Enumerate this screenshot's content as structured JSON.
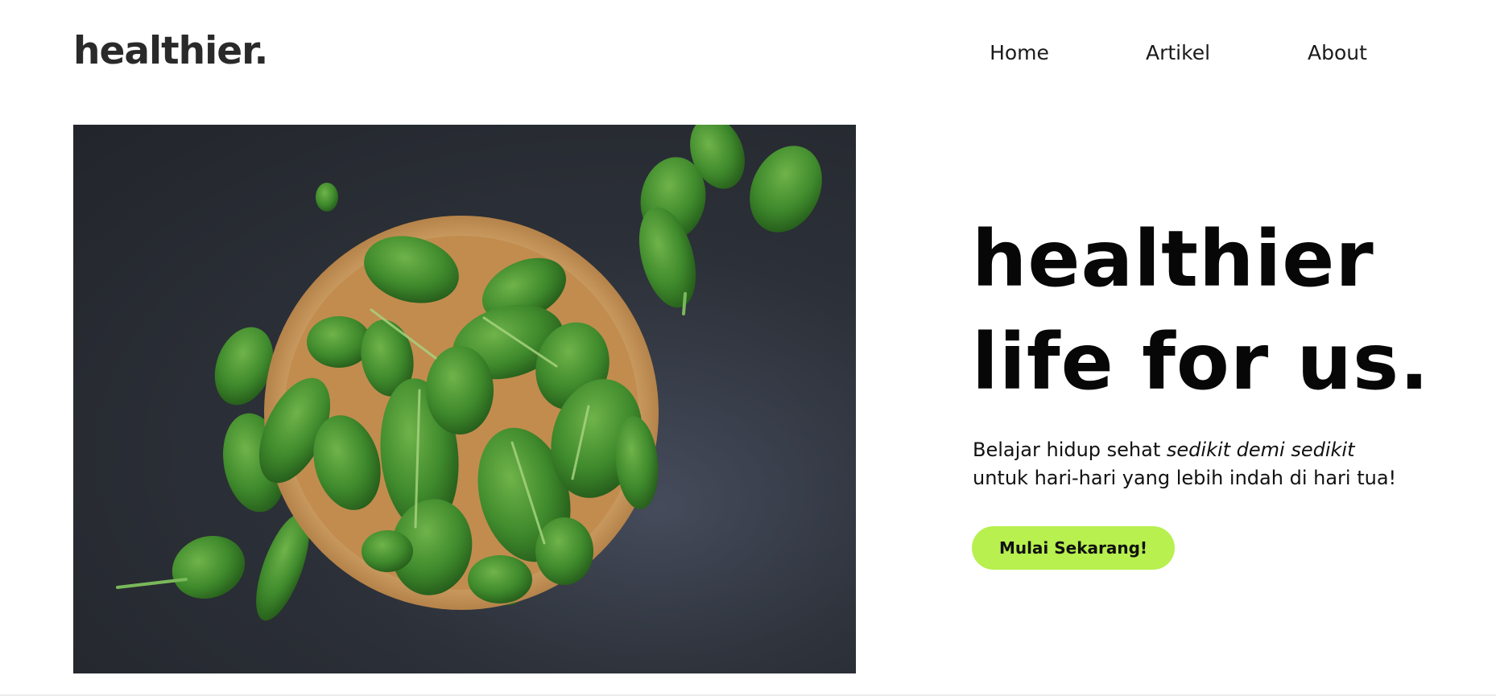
{
  "header": {
    "logo": "healthier.",
    "nav": [
      {
        "label": "Home"
      },
      {
        "label": "Artikel"
      },
      {
        "label": "About"
      }
    ]
  },
  "hero": {
    "image_subject": "bowl of fresh spinach leaves on dark table",
    "headline_line1": "healthier",
    "headline_line2": "life for us.",
    "subtext_prefix": "Belajar hidup sehat ",
    "subtext_emphasis": "sedikit demi sedikit",
    "subtext_line2": "untuk hari-hari yang lebih indah di hari tua!",
    "cta_label": "Mulai Sekarang!"
  },
  "colors": {
    "accent": "#b7f04f",
    "text": "#111111",
    "background": "#ffffff"
  }
}
